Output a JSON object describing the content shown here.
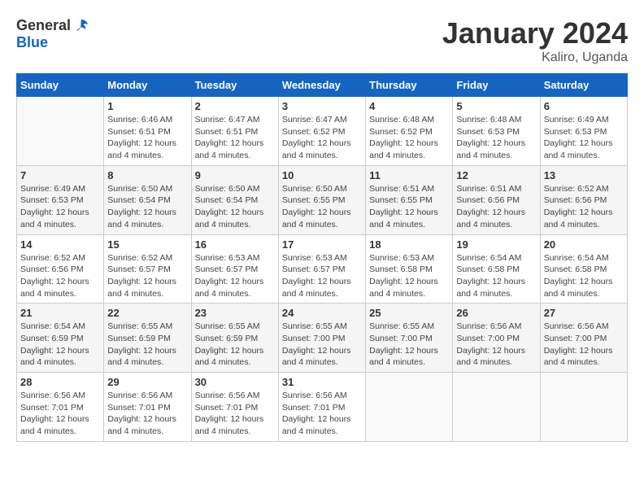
{
  "logo": {
    "text_general": "General",
    "text_blue": "Blue"
  },
  "title": "January 2024",
  "subtitle": "Kaliro, Uganda",
  "days_header": [
    "Sunday",
    "Monday",
    "Tuesday",
    "Wednesday",
    "Thursday",
    "Friday",
    "Saturday"
  ],
  "weeks": [
    [
      {
        "day": "",
        "info": ""
      },
      {
        "day": "1",
        "info": "Sunrise: 6:46 AM\nSunset: 6:51 PM\nDaylight: 12 hours\nand 4 minutes."
      },
      {
        "day": "2",
        "info": "Sunrise: 6:47 AM\nSunset: 6:51 PM\nDaylight: 12 hours\nand 4 minutes."
      },
      {
        "day": "3",
        "info": "Sunrise: 6:47 AM\nSunset: 6:52 PM\nDaylight: 12 hours\nand 4 minutes."
      },
      {
        "day": "4",
        "info": "Sunrise: 6:48 AM\nSunset: 6:52 PM\nDaylight: 12 hours\nand 4 minutes."
      },
      {
        "day": "5",
        "info": "Sunrise: 6:48 AM\nSunset: 6:53 PM\nDaylight: 12 hours\nand 4 minutes."
      },
      {
        "day": "6",
        "info": "Sunrise: 6:49 AM\nSunset: 6:53 PM\nDaylight: 12 hours\nand 4 minutes."
      }
    ],
    [
      {
        "day": "7",
        "info": "Sunrise: 6:49 AM\nSunset: 6:53 PM\nDaylight: 12 hours\nand 4 minutes."
      },
      {
        "day": "8",
        "info": "Sunrise: 6:50 AM\nSunset: 6:54 PM\nDaylight: 12 hours\nand 4 minutes."
      },
      {
        "day": "9",
        "info": "Sunrise: 6:50 AM\nSunset: 6:54 PM\nDaylight: 12 hours\nand 4 minutes."
      },
      {
        "day": "10",
        "info": "Sunrise: 6:50 AM\nSunset: 6:55 PM\nDaylight: 12 hours\nand 4 minutes."
      },
      {
        "day": "11",
        "info": "Sunrise: 6:51 AM\nSunset: 6:55 PM\nDaylight: 12 hours\nand 4 minutes."
      },
      {
        "day": "12",
        "info": "Sunrise: 6:51 AM\nSunset: 6:56 PM\nDaylight: 12 hours\nand 4 minutes."
      },
      {
        "day": "13",
        "info": "Sunrise: 6:52 AM\nSunset: 6:56 PM\nDaylight: 12 hours\nand 4 minutes."
      }
    ],
    [
      {
        "day": "14",
        "info": "Sunrise: 6:52 AM\nSunset: 6:56 PM\nDaylight: 12 hours\nand 4 minutes."
      },
      {
        "day": "15",
        "info": "Sunrise: 6:52 AM\nSunset: 6:57 PM\nDaylight: 12 hours\nand 4 minutes."
      },
      {
        "day": "16",
        "info": "Sunrise: 6:53 AM\nSunset: 6:57 PM\nDaylight: 12 hours\nand 4 minutes."
      },
      {
        "day": "17",
        "info": "Sunrise: 6:53 AM\nSunset: 6:57 PM\nDaylight: 12 hours\nand 4 minutes."
      },
      {
        "day": "18",
        "info": "Sunrise: 6:53 AM\nSunset: 6:58 PM\nDaylight: 12 hours\nand 4 minutes."
      },
      {
        "day": "19",
        "info": "Sunrise: 6:54 AM\nSunset: 6:58 PM\nDaylight: 12 hours\nand 4 minutes."
      },
      {
        "day": "20",
        "info": "Sunrise: 6:54 AM\nSunset: 6:58 PM\nDaylight: 12 hours\nand 4 minutes."
      }
    ],
    [
      {
        "day": "21",
        "info": "Sunrise: 6:54 AM\nSunset: 6:59 PM\nDaylight: 12 hours\nand 4 minutes."
      },
      {
        "day": "22",
        "info": "Sunrise: 6:55 AM\nSunset: 6:59 PM\nDaylight: 12 hours\nand 4 minutes."
      },
      {
        "day": "23",
        "info": "Sunrise: 6:55 AM\nSunset: 6:59 PM\nDaylight: 12 hours\nand 4 minutes."
      },
      {
        "day": "24",
        "info": "Sunrise: 6:55 AM\nSunset: 7:00 PM\nDaylight: 12 hours\nand 4 minutes."
      },
      {
        "day": "25",
        "info": "Sunrise: 6:55 AM\nSunset: 7:00 PM\nDaylight: 12 hours\nand 4 minutes."
      },
      {
        "day": "26",
        "info": "Sunrise: 6:56 AM\nSunset: 7:00 PM\nDaylight: 12 hours\nand 4 minutes."
      },
      {
        "day": "27",
        "info": "Sunrise: 6:56 AM\nSunset: 7:00 PM\nDaylight: 12 hours\nand 4 minutes."
      }
    ],
    [
      {
        "day": "28",
        "info": "Sunrise: 6:56 AM\nSunset: 7:01 PM\nDaylight: 12 hours\nand 4 minutes."
      },
      {
        "day": "29",
        "info": "Sunrise: 6:56 AM\nSunset: 7:01 PM\nDaylight: 12 hours\nand 4 minutes."
      },
      {
        "day": "30",
        "info": "Sunrise: 6:56 AM\nSunset: 7:01 PM\nDaylight: 12 hours\nand 4 minutes."
      },
      {
        "day": "31",
        "info": "Sunrise: 6:56 AM\nSunset: 7:01 PM\nDaylight: 12 hours\nand 4 minutes."
      },
      {
        "day": "",
        "info": ""
      },
      {
        "day": "",
        "info": ""
      },
      {
        "day": "",
        "info": ""
      }
    ]
  ]
}
